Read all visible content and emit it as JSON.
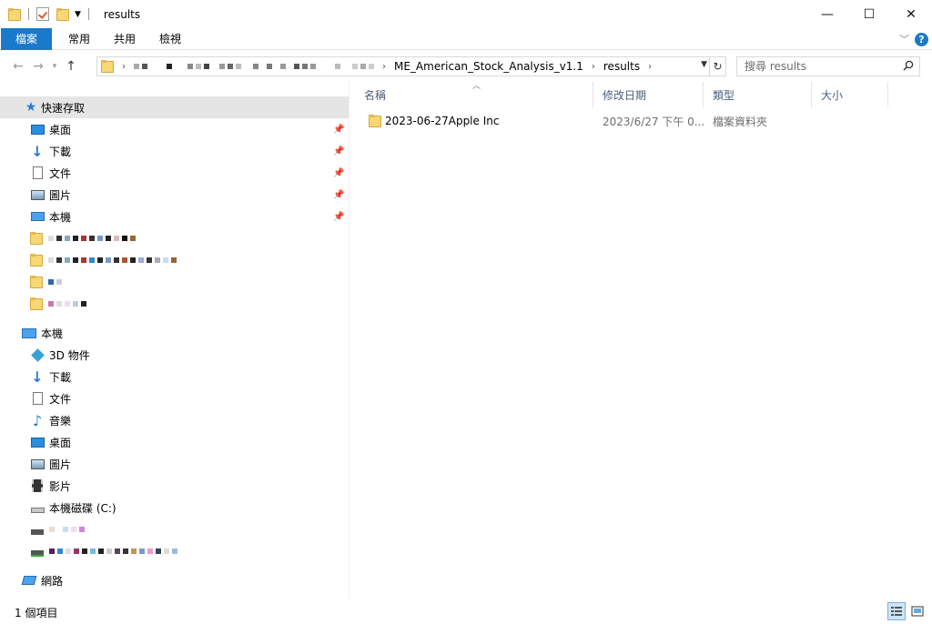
{
  "window": {
    "title": "results",
    "minimize_glyph": "—",
    "maximize_glyph": "☐",
    "close_glyph": "✕"
  },
  "ribbon": {
    "tabs": [
      "檔案",
      "常用",
      "共用",
      "檢視"
    ],
    "help_label": "?"
  },
  "address": {
    "crumbs": [
      "ME_American_Stock_Analysis_v1.1",
      "results"
    ],
    "search_placeholder": "搜尋 results"
  },
  "nav": {
    "quick_access": "快速存取",
    "pinned": [
      "桌面",
      "下載",
      "文件",
      "圖片",
      "本機"
    ],
    "this_pc": "本機",
    "pc_items": [
      "3D 物件",
      "下載",
      "文件",
      "音樂",
      "桌面",
      "圖片",
      "影片",
      "本機磁碟 (C:)"
    ],
    "network": "網路"
  },
  "columns": {
    "name": "名稱",
    "modified": "修改日期",
    "type": "類型",
    "size": "大小"
  },
  "files": [
    {
      "name": "2023-06-27Apple Inc",
      "modified": "2023/6/27 下午 0...",
      "type": "檔案資料夾",
      "size": ""
    }
  ],
  "status": {
    "count": "1 個項目"
  },
  "colors": {
    "accent": "#1979ca",
    "folder": "#f8d775",
    "selection": "#e5e5e5"
  }
}
